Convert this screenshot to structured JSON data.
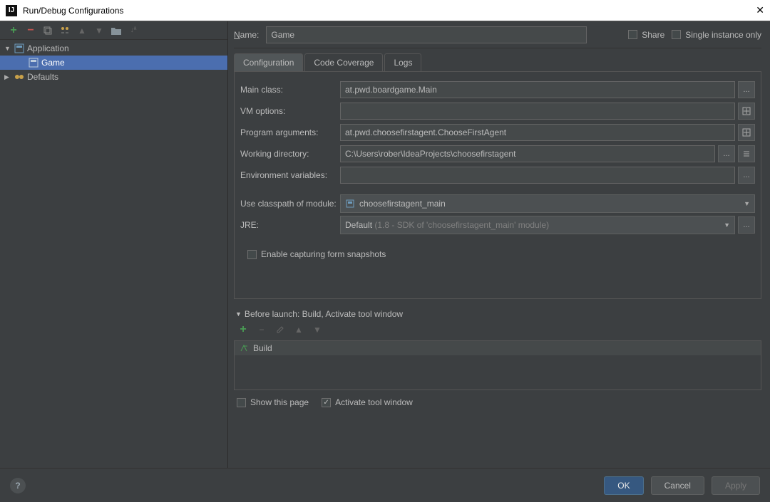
{
  "titlebar": {
    "title": "Run/Debug Configurations"
  },
  "leftTree": {
    "application": {
      "label": "Application"
    },
    "game": {
      "label": "Game"
    },
    "defaults": {
      "label": "Defaults"
    }
  },
  "nameRow": {
    "label": "Name:",
    "value": "Game",
    "share": "Share",
    "singleInstance": "Single instance only"
  },
  "tabs": {
    "configuration": "Configuration",
    "codeCoverage": "Code Coverage",
    "logs": "Logs"
  },
  "form": {
    "mainClass": {
      "label": "Main class:",
      "value": "at.pwd.boardgame.Main"
    },
    "vmOptions": {
      "label": "VM options:",
      "value": ""
    },
    "programArgs": {
      "label": "Program arguments:",
      "value": "at.pwd.choosefirstagent.ChooseFirstAgent"
    },
    "workingDir": {
      "label": "Working directory:",
      "value": "C:\\Users\\rober\\IdeaProjects\\choosefirstagent"
    },
    "envVars": {
      "label": "Environment variables:",
      "value": ""
    },
    "classpath": {
      "label": "Use classpath of module:",
      "value": "choosefirstagent_main"
    },
    "jre": {
      "label": "JRE:",
      "prefix": "Default",
      "suffix": " (1.8 - SDK of 'choosefirstagent_main' module)"
    },
    "enableSnapshots": "Enable capturing form snapshots"
  },
  "beforeLaunch": {
    "title": "Before launch: Build, Activate tool window",
    "build": "Build",
    "showThisPage": "Show this page",
    "activateToolWindow": "Activate tool window"
  },
  "buttons": {
    "ok": "OK",
    "cancel": "Cancel",
    "apply": "Apply"
  },
  "ellipsis": "..."
}
